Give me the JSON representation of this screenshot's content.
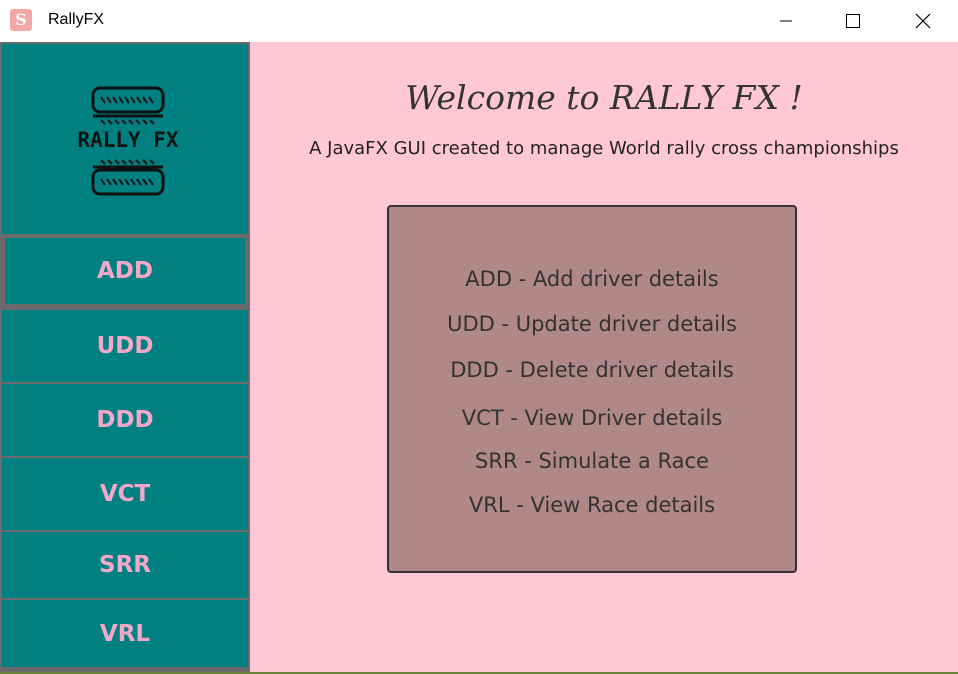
{
  "window": {
    "title": "RallyFX",
    "app_icon_glyph": "S",
    "controls": {
      "minimize": "minimize-icon",
      "maximize": "maximize-icon",
      "close": "close-icon"
    }
  },
  "logo": {
    "text": "RALLY FX",
    "icon": "tire-logo"
  },
  "sidebar": {
    "buttons": [
      {
        "label": "ADD"
      },
      {
        "label": "UDD"
      },
      {
        "label": "DDD"
      },
      {
        "label": "VCT"
      },
      {
        "label": "SRR"
      },
      {
        "label": "VRL"
      }
    ]
  },
  "content": {
    "welcome": "Welcome to RALLY FX !",
    "subtitle": "A JavaFX GUI created  to manage World rally cross championships",
    "items": [
      "ADD - Add driver details",
      "UDD - Update driver details",
      "DDD - Delete driver details",
      "VCT - View Driver details",
      "SRR - Simulate a Race",
      "VRL - View Race details"
    ]
  },
  "colors": {
    "sidebar": "#008080",
    "sidebar_text": "#f4a7c8",
    "content_bg": "#ffc8d4",
    "box_bg": "#b08888"
  }
}
